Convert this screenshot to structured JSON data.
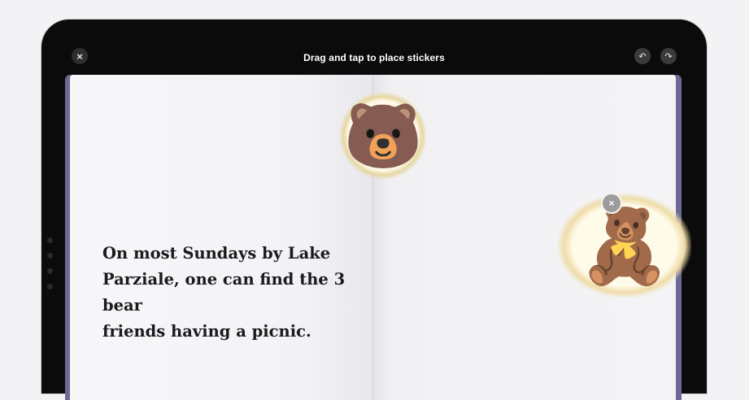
{
  "toolbar": {
    "title": "Drag and tap to place stickers",
    "close_icon": "×",
    "undo_icon": "↶",
    "redo_icon": "↷"
  },
  "book": {
    "left_page": {
      "text_line1": "On most Sundays by Lake",
      "text_line2": "Parziale, one can find the 3 bear",
      "text_line3": "friends having a picnic."
    },
    "right_page": {
      "image": "picnic-lake-photo"
    }
  },
  "stickers": {
    "brown_bear": {
      "glyph": "🐻",
      "icon": "bear-face-icon"
    },
    "teddy_bear": {
      "glyph": "🧸",
      "icon": "teddy-bear-icon"
    },
    "remove_icon": "×"
  },
  "colors": {
    "device_frame": "#0b0b0c",
    "book_cover": "#6c6a94",
    "page": "#f4f4f6"
  }
}
